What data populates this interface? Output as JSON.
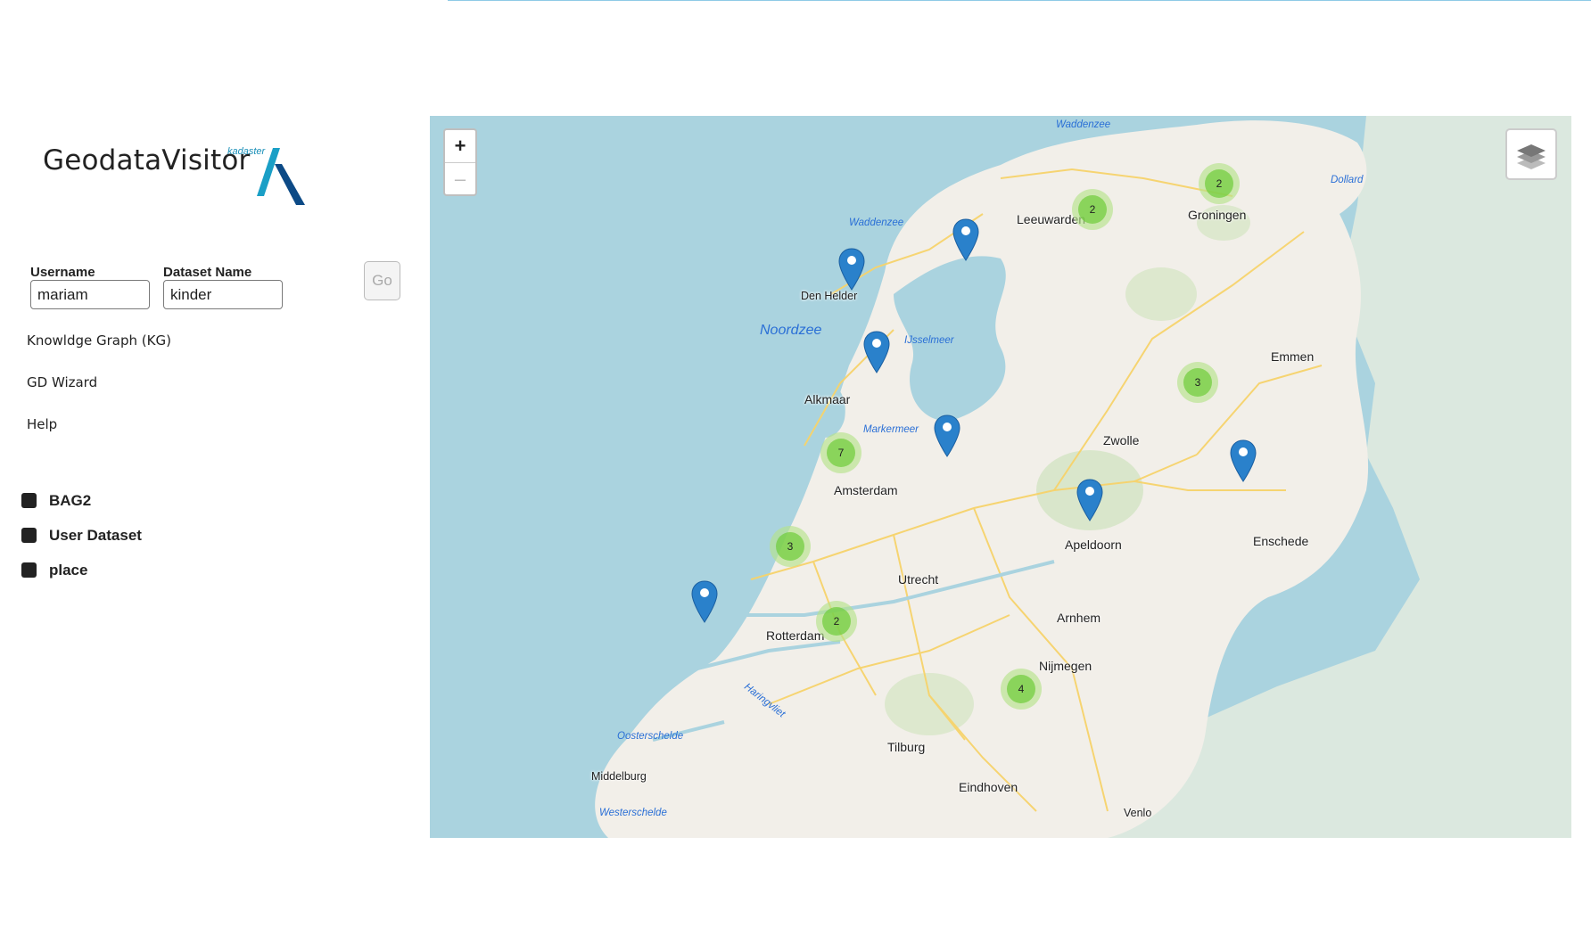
{
  "app": {
    "title": "GeodataVisitor",
    "brand": "kadaster"
  },
  "form": {
    "username_label": "Username",
    "username_value": "mariam",
    "dataset_label": "Dataset Name",
    "dataset_value": "kinder",
    "go_label": "Go"
  },
  "nav": {
    "items": [
      {
        "label": "Knowldge Graph (KG)"
      },
      {
        "label": "GD Wizard"
      },
      {
        "label": "Help"
      }
    ]
  },
  "legend": {
    "items": [
      {
        "label": "BAG2"
      },
      {
        "label": "User Dataset"
      },
      {
        "label": "place"
      }
    ]
  },
  "map": {
    "zoom_in": "+",
    "zoom_out": "–",
    "clusters": [
      "2",
      "2",
      "3",
      "7",
      "3",
      "2",
      "4"
    ],
    "cities": [
      "Leeuwarden",
      "Groningen",
      "Den Helder",
      "Emmen",
      "Alkmaar",
      "Zwolle",
      "Amsterdam",
      "Apeldoorn",
      "Enschede",
      "Utrecht",
      "Arnhem",
      "Rotterdam",
      "Nijmegen",
      "Tilburg",
      "Eindhoven",
      "Middelburg",
      "Venlo"
    ],
    "waters": [
      "Waddenzee",
      "Waddenzee",
      "Dollard",
      "Noordzee",
      "IJsselmeer",
      "Markermeer",
      "Haringvliet",
      "Oosterschelde",
      "Westerschelde"
    ],
    "colors": {
      "cluster_outer": "#b5e28c",
      "cluster_inner": "#6ecc39",
      "marker": "#2a81cb",
      "sea": "#aad3df",
      "land": "#f2efe9"
    },
    "icons": {
      "layers": "layers-icon",
      "marker": "map-marker-icon"
    }
  }
}
